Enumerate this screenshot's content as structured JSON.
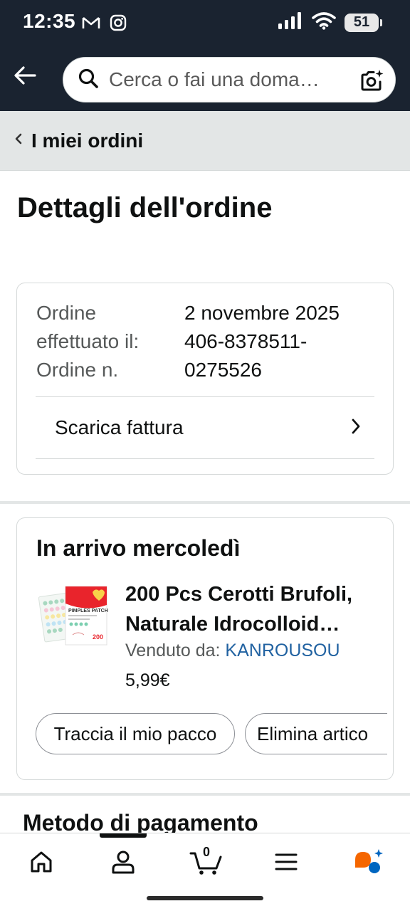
{
  "status_bar": {
    "time": "12:35",
    "battery": "51",
    "app_icons": [
      "gmail-icon",
      "instagram-icon"
    ],
    "system_icons": [
      "signal-icon",
      "wifi-icon",
      "battery-icon"
    ]
  },
  "search": {
    "placeholder": "Cerca o fai una doma…"
  },
  "breadcrumb": {
    "label": "I miei ordini"
  },
  "page": {
    "title": "Dettagli dell'ordine"
  },
  "order_summary": {
    "date_label": "Ordine effettuato il:",
    "number_label": "Ordine n.",
    "date_value": "2 novembre 2025",
    "number_value": "406-8378511-0275526",
    "invoice_label": "Scarica fattura"
  },
  "delivery": {
    "heading": "In arrivo mercoledì",
    "product_title": "200 Pcs Cerotti Brufoli, Naturale Idrocolloid…",
    "seller_prefix": "Venduto da:",
    "seller_name": "KANROUSOU",
    "price": "5,99€",
    "thumb_brand": "PIMPLES PATCH",
    "thumb_count": "200",
    "track_button": "Traccia il mio pacco",
    "delete_button": "Elimina artico"
  },
  "payment": {
    "heading": "Metodo di pagamento"
  },
  "bottom_nav": {
    "items": [
      "home-icon",
      "account-icon",
      "cart-icon",
      "menu-icon",
      "rufus-icon"
    ],
    "cart_count": "0",
    "active_index": 1
  },
  "colors": {
    "header_bg": "#1a2330",
    "link": "#2162a1",
    "breadcrumb_bg": "#e3e6e6",
    "rufus_orange": "#f56600",
    "rufus_blue": "#0066c0"
  }
}
